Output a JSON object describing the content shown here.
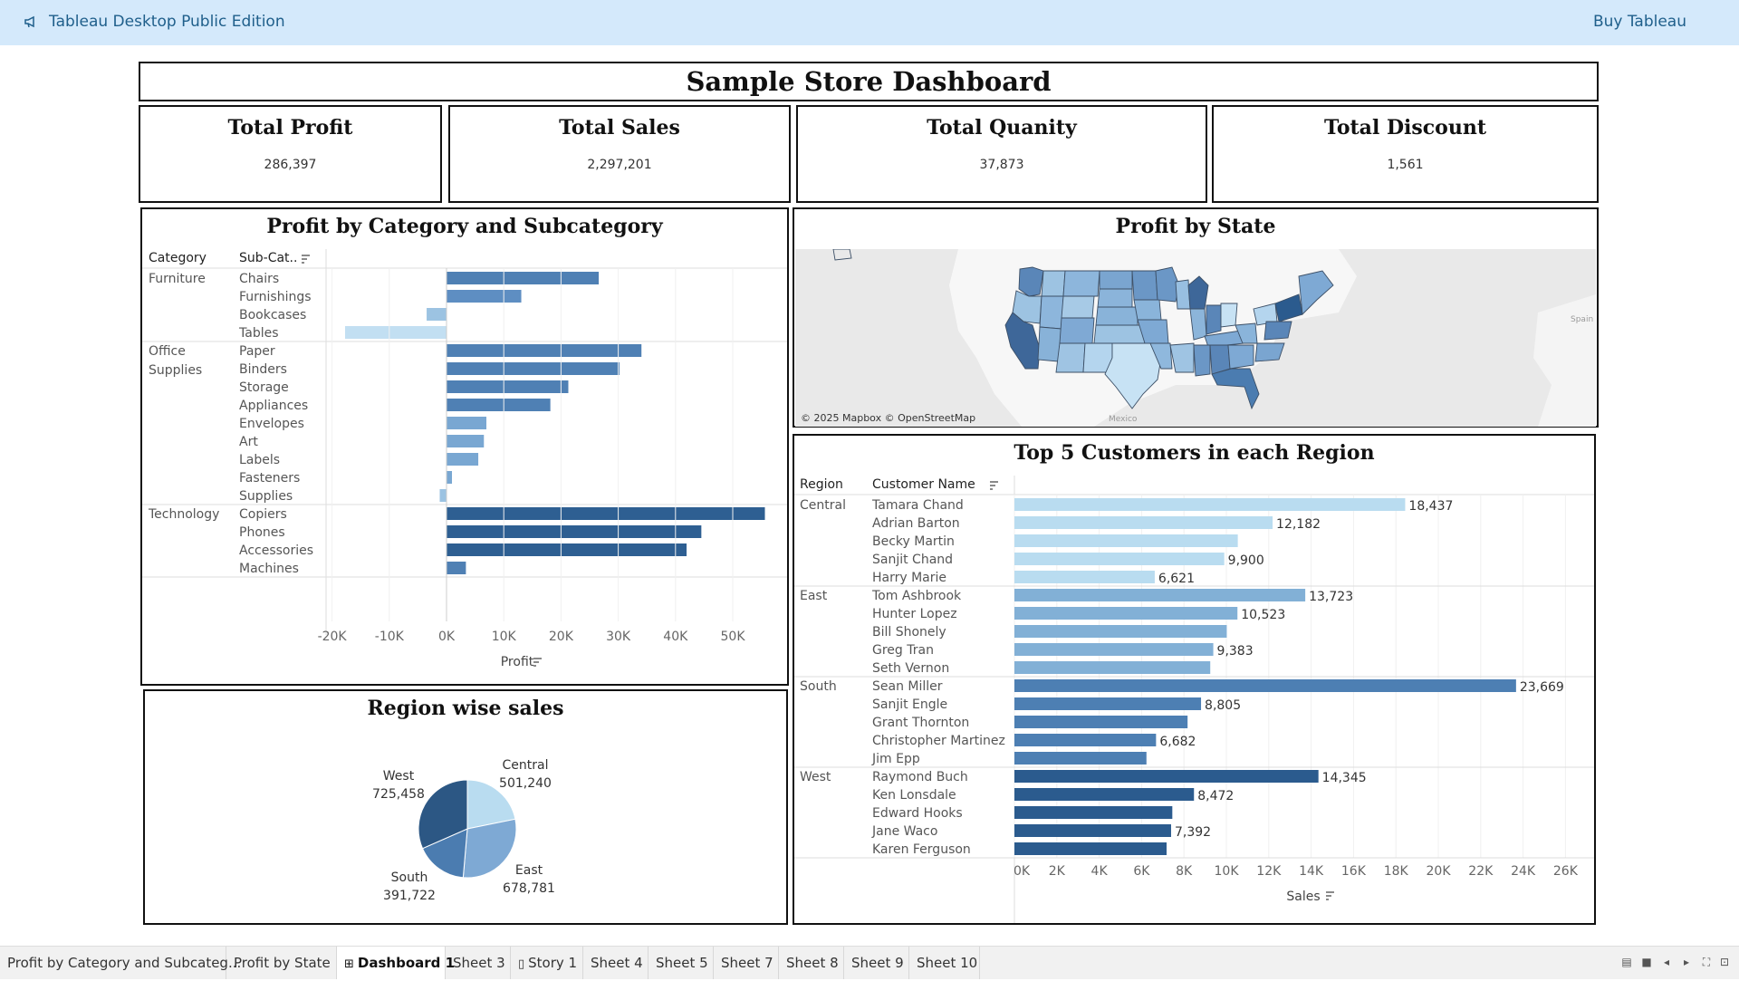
{
  "app": {
    "title": "Tableau Desktop Public Edition",
    "buy_label": "Buy Tableau"
  },
  "dashboard": {
    "title": "Sample Store Dashboard"
  },
  "kpis": [
    {
      "label": "Total Profit",
      "value": "286,397"
    },
    {
      "label": "Total Sales",
      "value": "2,297,201"
    },
    {
      "label": "Total Quanity",
      "value": "37,873"
    },
    {
      "label": "Total Discount",
      "value": "1,561"
    }
  ],
  "category_chart": {
    "title": "Profit by Category and Subcategory",
    "col_category": "Category",
    "col_subcategory": "Sub-Cat..",
    "xlabel": "Profit",
    "ticks": [
      "-20K",
      "-10K",
      "0K",
      "10K",
      "20K",
      "30K",
      "40K",
      "50K"
    ]
  },
  "map_chart": {
    "title": "Profit by State",
    "attribution": "© 2025 Mapbox © OpenStreetMap",
    "label_mexico": "Mexico",
    "label_spain": "Spain"
  },
  "customer_chart": {
    "title": "Top 5 Customers in each Region",
    "col_region": "Region",
    "col_customer": "Customer Name",
    "xlabel": "Sales",
    "ticks": [
      "0K",
      "2K",
      "4K",
      "6K",
      "8K",
      "10K",
      "12K",
      "14K",
      "16K",
      "18K",
      "20K",
      "22K",
      "24K",
      "26K"
    ]
  },
  "pie_chart": {
    "title": "Region wise sales"
  },
  "chart_data": [
    {
      "type": "bar",
      "title": "Profit by Category and Subcategory",
      "xlabel": "Profit",
      "xlim": [
        -21000,
        60000
      ],
      "groups": [
        {
          "category": "Furniture",
          "items": [
            {
              "name": "Chairs",
              "value": 26590
            },
            {
              "name": "Furnishings",
              "value": 13059
            },
            {
              "name": "Bookcases",
              "value": -3473
            },
            {
              "name": "Tables",
              "value": -17725
            }
          ]
        },
        {
          "category": "Office Supplies",
          "items": [
            {
              "name": "Paper",
              "value": 34054
            },
            {
              "name": "Binders",
              "value": 30222
            },
            {
              "name": "Storage",
              "value": 21279
            },
            {
              "name": "Appliances",
              "value": 18138
            },
            {
              "name": "Envelopes",
              "value": 6964
            },
            {
              "name": "Art",
              "value": 6528
            },
            {
              "name": "Labels",
              "value": 5546
            },
            {
              "name": "Fasteners",
              "value": 950
            },
            {
              "name": "Supplies",
              "value": -1189
            }
          ]
        },
        {
          "category": "Technology",
          "items": [
            {
              "name": "Copiers",
              "value": 55618
            },
            {
              "name": "Phones",
              "value": 44516
            },
            {
              "name": "Accessories",
              "value": 41937
            },
            {
              "name": "Machines",
              "value": 3385
            }
          ]
        }
      ]
    },
    {
      "type": "bar",
      "title": "Top 5 Customers in each Region",
      "xlabel": "Sales",
      "xlim": [
        0,
        27000
      ],
      "groups": [
        {
          "region": "Central",
          "color": "#b9dcf0",
          "items": [
            {
              "name": "Tamara Chand",
              "value": 18437,
              "label": "18,437"
            },
            {
              "name": "Adrian Barton",
              "value": 12182,
              "label": "12,182"
            },
            {
              "name": "Becky Martin",
              "value": 10540,
              "label": ""
            },
            {
              "name": "Sanjit Chand",
              "value": 9900,
              "label": "9,900"
            },
            {
              "name": "Harry Marie",
              "value": 6621,
              "label": "6,621"
            }
          ]
        },
        {
          "region": "East",
          "color": "#82b0d6",
          "items": [
            {
              "name": "Tom Ashbrook",
              "value": 13723,
              "label": "13,723"
            },
            {
              "name": "Hunter Lopez",
              "value": 10523,
              "label": "10,523"
            },
            {
              "name": "Bill Shonely",
              "value": 10020,
              "label": ""
            },
            {
              "name": "Greg Tran",
              "value": 9383,
              "label": "9,383"
            },
            {
              "name": "Seth Vernon",
              "value": 9240,
              "label": ""
            }
          ]
        },
        {
          "region": "South",
          "color": "#4d7fb3",
          "items": [
            {
              "name": "Sean Miller",
              "value": 23669,
              "label": "23,669"
            },
            {
              "name": "Sanjit Engle",
              "value": 8805,
              "label": "8,805"
            },
            {
              "name": "Grant Thornton",
              "value": 8170,
              "label": ""
            },
            {
              "name": "Christopher Martinez",
              "value": 6682,
              "label": "6,682"
            },
            {
              "name": "Jim Epp",
              "value": 6230,
              "label": ""
            }
          ]
        },
        {
          "region": "West",
          "color": "#2b5b8e",
          "items": [
            {
              "name": "Raymond Buch",
              "value": 14345,
              "label": "14,345"
            },
            {
              "name": "Ken Lonsdale",
              "value": 8472,
              "label": "8,472"
            },
            {
              "name": "Edward Hooks",
              "value": 7450,
              "label": ""
            },
            {
              "name": "Jane Waco",
              "value": 7392,
              "label": "7,392"
            },
            {
              "name": "Karen Ferguson",
              "value": 7180,
              "label": ""
            }
          ]
        }
      ]
    },
    {
      "type": "pie",
      "title": "Region wise sales",
      "slices": [
        {
          "name": "Central",
          "value": 501240,
          "label": "501,240",
          "color": "#b9dcf0"
        },
        {
          "name": "East",
          "value": 678781,
          "label": "678,781",
          "color": "#7ea9d4"
        },
        {
          "name": "South",
          "value": 391722,
          "label": "391,722",
          "color": "#4b7cb0"
        },
        {
          "name": "West",
          "value": 725458,
          "label": "725,458",
          "color": "#2c5784"
        }
      ]
    }
  ],
  "tabs": [
    {
      "label": "Profit by Category and Subcateg...",
      "icon": ""
    },
    {
      "label": "Profit by State",
      "icon": ""
    },
    {
      "label": "Dashboard 1",
      "icon": "⊞",
      "active": true
    },
    {
      "label": "Sheet 3",
      "icon": ""
    },
    {
      "label": "Story 1",
      "icon": "▯"
    },
    {
      "label": "Sheet 4",
      "icon": ""
    },
    {
      "label": "Sheet 5",
      "icon": ""
    },
    {
      "label": "Sheet 7",
      "icon": ""
    },
    {
      "label": "Sheet 8",
      "icon": ""
    },
    {
      "label": "Sheet 9",
      "icon": ""
    },
    {
      "label": "Sheet 10",
      "icon": ""
    }
  ],
  "colors": {
    "topbar": "#d4e9fb",
    "link": "#1f5f8b"
  }
}
